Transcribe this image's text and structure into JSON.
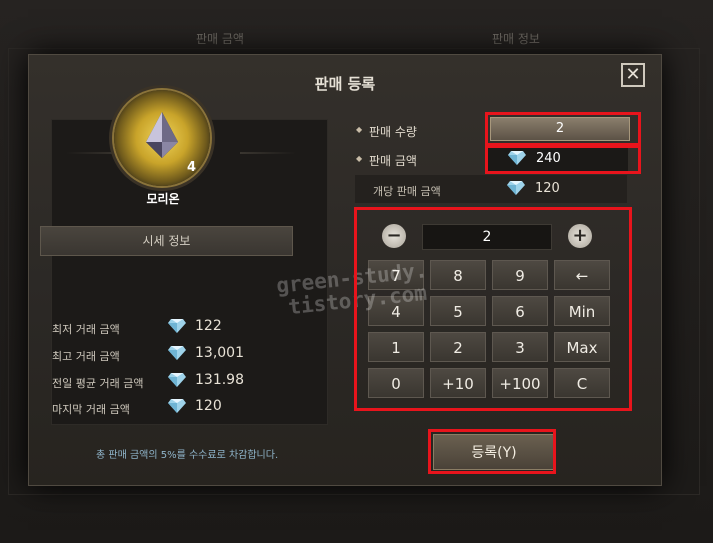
{
  "background": {
    "tabs": [
      "판매 금액",
      "판매 정보"
    ]
  },
  "dialog": {
    "title": "판매 등록",
    "close_icon": "close-icon"
  },
  "item": {
    "name": "모리온",
    "count": "4",
    "icon": "gem-icon"
  },
  "market": {
    "header": "시세 정보",
    "rows": [
      {
        "label": "최저 거래 금액",
        "value": "122"
      },
      {
        "label": "최고 거래 금액",
        "value": "13,001"
      },
      {
        "label": "전일 평균 거래 금액",
        "value": "131.98"
      },
      {
        "label": "마지막 거래 금액",
        "value": "120"
      }
    ]
  },
  "sale": {
    "quantity_label": "판매 수량",
    "quantity_value": "2",
    "price_label": "판매 금액",
    "price_value": "240",
    "unit_label": "개당 판매 금액",
    "unit_value": "120"
  },
  "numpad": {
    "display": "2",
    "minus": "−",
    "plus": "+",
    "keys": [
      "7",
      "8",
      "9",
      "←",
      "4",
      "5",
      "6",
      "Min",
      "1",
      "2",
      "3",
      "Max",
      "0",
      "+10",
      "+100",
      "C"
    ]
  },
  "footer": {
    "hint": "총 판매 금액의 5%를 수수료로 차감합니다.",
    "register_button": "등록(Y)"
  },
  "watermark": {
    "line1": "green-study.",
    "line2": "tistory.com"
  },
  "colors": {
    "highlight": "#e8141c",
    "hint": "#8fb4c9",
    "gold": "#c9a42a"
  }
}
